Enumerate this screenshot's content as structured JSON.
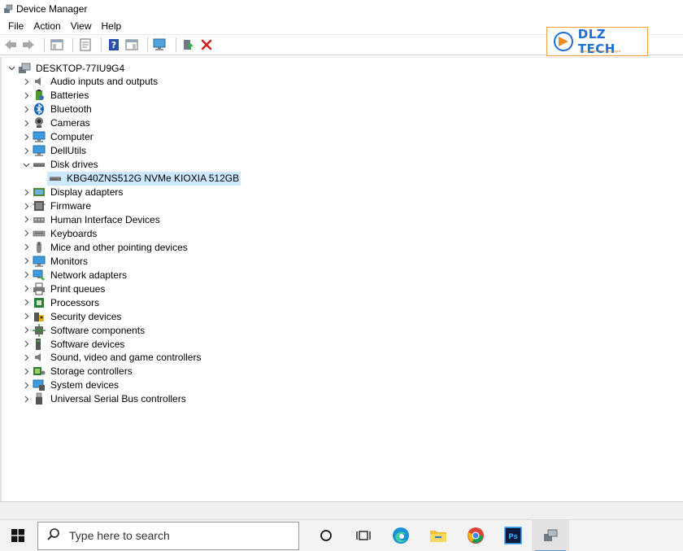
{
  "window": {
    "title": "Device Manager"
  },
  "menu": [
    "File",
    "Action",
    "View",
    "Help"
  ],
  "logo": {
    "text": "DLZ TECH",
    "subtitle": "Chia sẻ kiến thức công nghệ"
  },
  "tree": {
    "root": "DESKTOP-77IU9G4",
    "categories": [
      {
        "label": "Audio inputs and outputs",
        "icon": "speaker-icon",
        "expanded": false
      },
      {
        "label": "Batteries",
        "icon": "battery-icon",
        "expanded": false
      },
      {
        "label": "Bluetooth",
        "icon": "bluetooth-icon",
        "expanded": false
      },
      {
        "label": "Cameras",
        "icon": "camera-icon",
        "expanded": false
      },
      {
        "label": "Computer",
        "icon": "computer-icon",
        "expanded": false
      },
      {
        "label": "DellUtils",
        "icon": "monitor-icon",
        "expanded": false
      },
      {
        "label": "Disk drives",
        "icon": "disk-drive-icon",
        "expanded": true,
        "children": [
          "KBG40ZNS512G NVMe KIOXIA 512GB"
        ]
      },
      {
        "label": "Display adapters",
        "icon": "display-adapter-icon",
        "expanded": false
      },
      {
        "label": "Firmware",
        "icon": "firmware-icon",
        "expanded": false
      },
      {
        "label": "Human Interface Devices",
        "icon": "hid-icon",
        "expanded": false
      },
      {
        "label": "Keyboards",
        "icon": "keyboard-icon",
        "expanded": false
      },
      {
        "label": "Mice and other pointing devices",
        "icon": "mouse-icon",
        "expanded": false
      },
      {
        "label": "Monitors",
        "icon": "monitor-icon",
        "expanded": false
      },
      {
        "label": "Network adapters",
        "icon": "network-icon",
        "expanded": false
      },
      {
        "label": "Print queues",
        "icon": "printer-icon",
        "expanded": false
      },
      {
        "label": "Processors",
        "icon": "processor-icon",
        "expanded": false
      },
      {
        "label": "Security devices",
        "icon": "security-icon",
        "expanded": false
      },
      {
        "label": "Software components",
        "icon": "software-component-icon",
        "expanded": false
      },
      {
        "label": "Software devices",
        "icon": "software-device-icon",
        "expanded": false
      },
      {
        "label": "Sound, video and game controllers",
        "icon": "speaker-icon",
        "expanded": false
      },
      {
        "label": "Storage controllers",
        "icon": "storage-controller-icon",
        "expanded": false
      },
      {
        "label": "System devices",
        "icon": "system-device-icon",
        "expanded": false
      },
      {
        "label": "Universal Serial Bus controllers",
        "icon": "usb-icon",
        "expanded": false
      }
    ]
  },
  "taskbar": {
    "search_placeholder": "Type here to search",
    "apps": [
      "cortana-icon",
      "task-view-icon",
      "edge-icon",
      "file-explorer-icon",
      "chrome-icon",
      "photoshop-icon",
      "device-manager-icon"
    ]
  },
  "colors": {
    "selection": "#cce8ff",
    "accent": "#1e6fd9",
    "logo_border": "#f0a040"
  }
}
